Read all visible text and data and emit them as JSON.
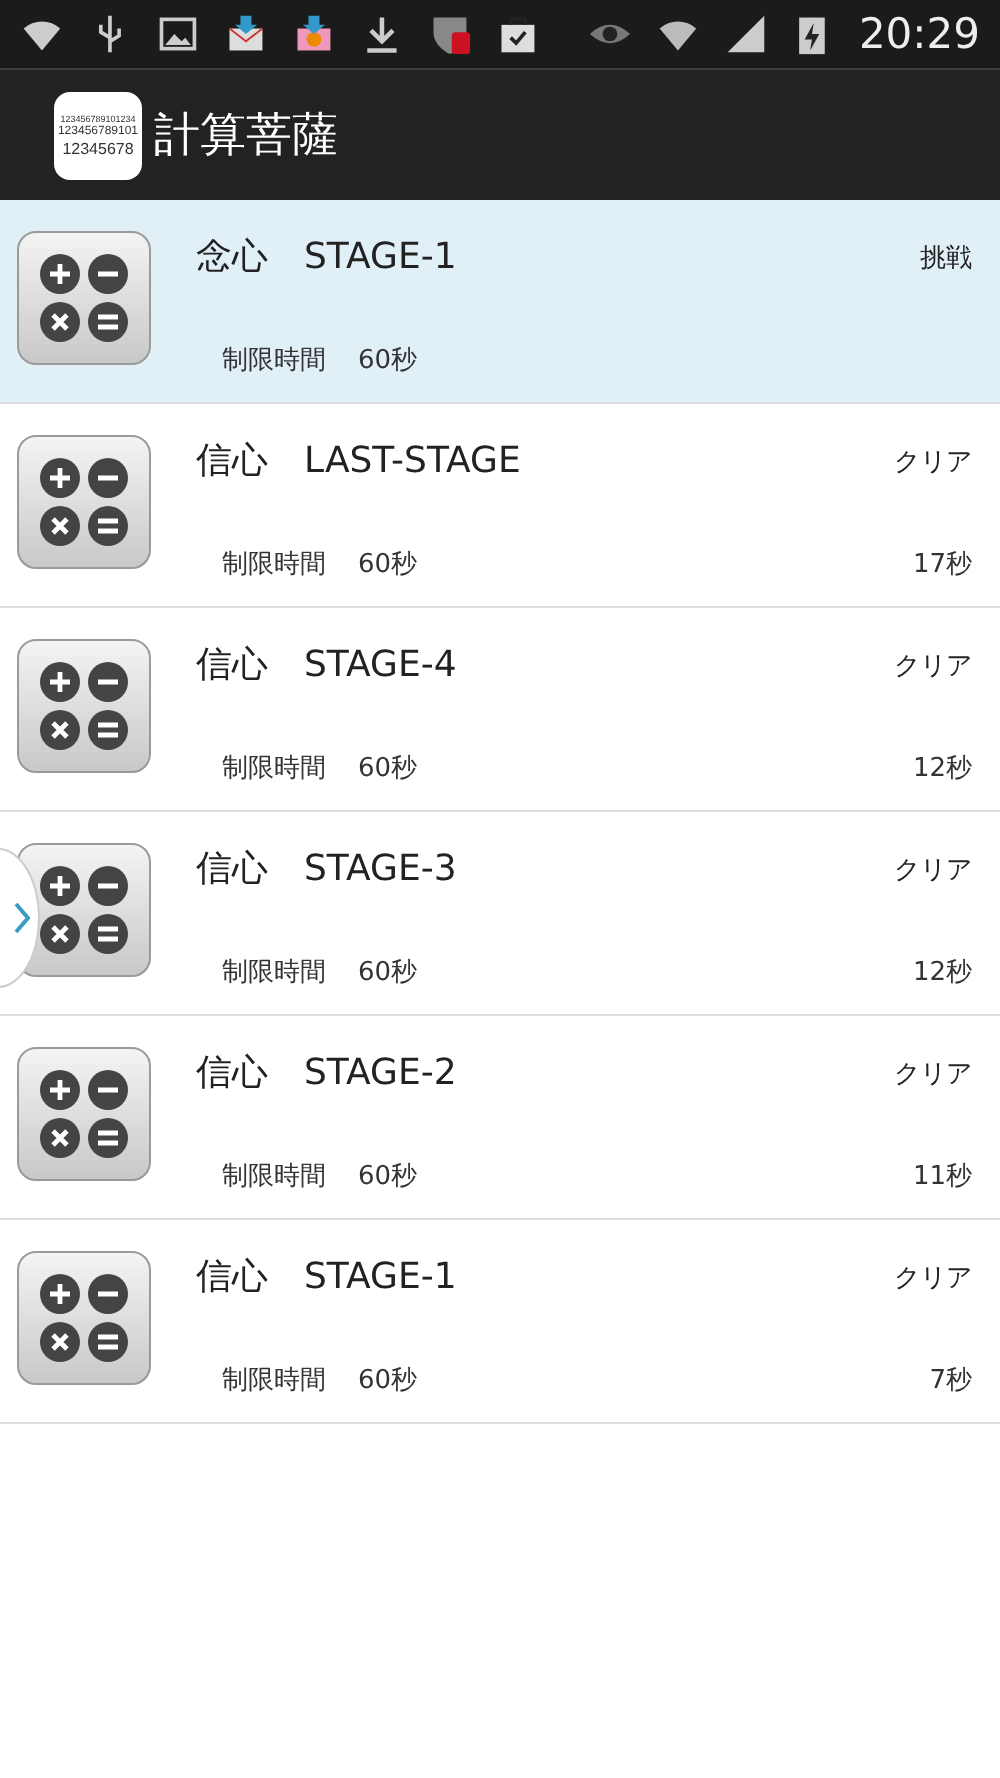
{
  "status_bar": {
    "time": "20:29"
  },
  "app_bar": {
    "logo_lines": [
      "123456789101234",
      "123456789101",
      "12345678"
    ],
    "title": "計算菩薩"
  },
  "stages": [
    {
      "title": "念心　STAGE-1",
      "status": "挑戦",
      "limit_label": "制限時間",
      "limit": "60秒",
      "selected": true
    },
    {
      "title": "信心　LAST-STAGE",
      "status": "クリア",
      "limit_label": "制限時間",
      "limit": "60秒",
      "result": "17秒",
      "selected": false
    },
    {
      "title": "信心　STAGE-4",
      "status": "クリア",
      "limit_label": "制限時間",
      "limit": "60秒",
      "result": "12秒",
      "selected": false
    },
    {
      "title": "信心　STAGE-3",
      "status": "クリア",
      "limit_label": "制限時間",
      "limit": "60秒",
      "result": "12秒",
      "selected": false
    },
    {
      "title": "信心　STAGE-2",
      "status": "クリア",
      "limit_label": "制限時間",
      "limit": "60秒",
      "result": "11秒",
      "selected": false
    },
    {
      "title": "信心　STAGE-1",
      "status": "クリア",
      "limit_label": "制限時間",
      "limit": "60秒",
      "result": "7秒",
      "selected": false
    }
  ]
}
